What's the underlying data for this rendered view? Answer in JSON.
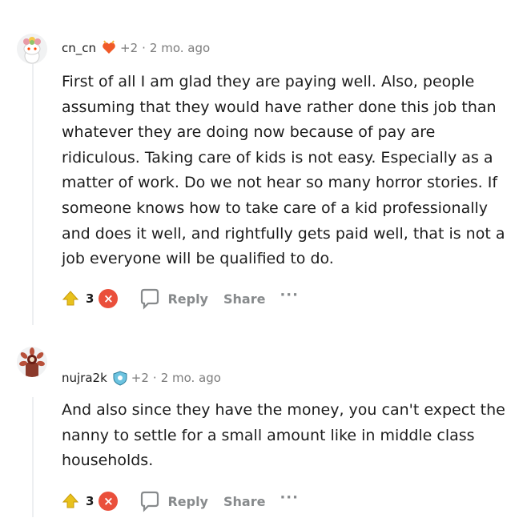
{
  "comments": [
    {
      "username": "cn_cn",
      "points": "+2",
      "separator": "·",
      "age": "2 mo. ago",
      "body": "First of all I am glad they are paying well. Also, people assuming that they would have rather done this job than whatever they are doing now because of pay are ridiculous. Taking care of kids is not easy. Especially as a matter of work. Do we not hear so many horror stories. If someone knows how to take care of a kid professionally and does it well, and rightfully gets paid well, that is not a job everyone will be qualified to do.",
      "score": "3",
      "reply_label": "Reply",
      "share_label": "Share",
      "more_label": "···"
    },
    {
      "username": "nujra2k",
      "points": "+2",
      "separator": "·",
      "age": "2 mo. ago",
      "body": "And also since they have the money, you can't expect the nanny to settle for a small amount like in middle class households.",
      "score": "3",
      "reply_label": "Reply",
      "share_label": "Share",
      "more_label": "···"
    }
  ],
  "colors": {
    "upvote": "#e8c11c",
    "downvote": "#ea4f3b",
    "meta": "#7c7c7c",
    "action": "#878a8c"
  },
  "icons": [
    "flower-avatar-icon",
    "heart-flair-icon",
    "demogorgon-avatar-icon",
    "shield-flair-icon",
    "upvote-arrow-icon",
    "downvote-x-icon",
    "reply-bubble-icon"
  ]
}
